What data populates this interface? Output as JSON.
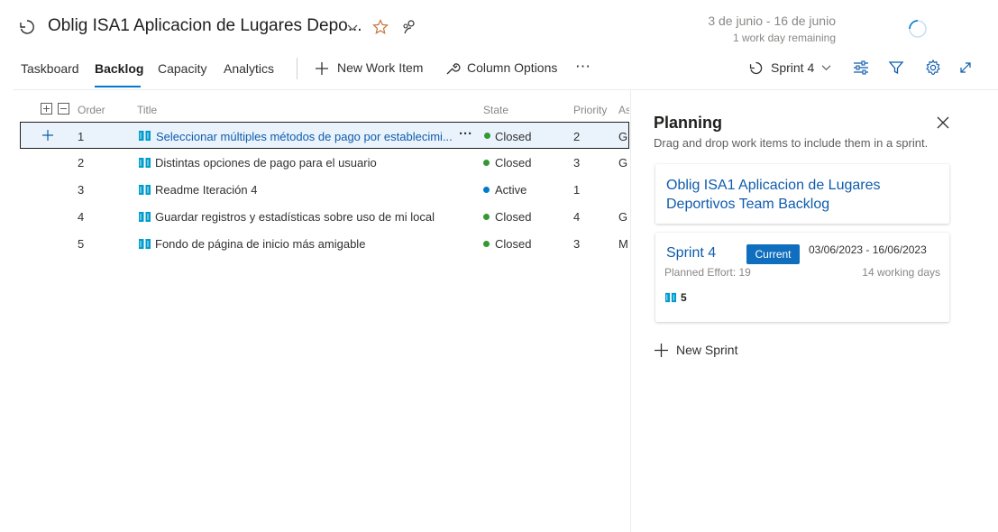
{
  "header": {
    "title": "Oblig ISA1 Aplicacion de Lugares Depo...",
    "sprint_dates": "3 de junio - 16 de junio",
    "sprint_remaining": "1 work day remaining",
    "icons": [
      "sprint-cycle-icon",
      "chevron-down-icon",
      "star-icon",
      "team-members-icon",
      "loading-spinner-icon"
    ]
  },
  "tabs": [
    {
      "label": "Taskboard",
      "active": false
    },
    {
      "label": "Backlog",
      "active": true
    },
    {
      "label": "Capacity",
      "active": false
    },
    {
      "label": "Analytics",
      "active": false
    }
  ],
  "toolbar": {
    "new_work_item": "New Work Item",
    "column_options": "Column Options",
    "more": "⋯",
    "sprint_selector": "Sprint 4"
  },
  "grid": {
    "columns": {
      "order": "Order",
      "title": "Title",
      "state": "State",
      "priority": "Priority",
      "assigned": "As"
    },
    "rows": [
      {
        "order": "1",
        "title": "Seleccionar múltiples métodos de pago por establecimi...",
        "state": "Closed",
        "priority": "2",
        "assigned": "G"
      },
      {
        "order": "2",
        "title": "Distintas opciones de pago para el usuario",
        "state": "Closed",
        "priority": "3",
        "assigned": "G"
      },
      {
        "order": "3",
        "title": "Readme Iteración 4",
        "state": "Active",
        "priority": "1",
        "assigned": ""
      },
      {
        "order": "4",
        "title": "Guardar registros y estadísticas sobre uso de mi local",
        "state": "Closed",
        "priority": "4",
        "assigned": "G"
      },
      {
        "order": "5",
        "title": "Fondo de página de inicio más amigable",
        "state": "Closed",
        "priority": "3",
        "assigned": "M"
      }
    ],
    "state_colors": {
      "Closed": "#339933",
      "Active": "#007acc"
    }
  },
  "planning": {
    "title": "Planning",
    "subtitle": "Drag and drop work items to include them in a sprint.",
    "backlog_card": "Oblig ISA1 Aplicacion de Lugares Deportivos Team Backlog",
    "sprint": {
      "name": "Sprint 4",
      "badge": "Current",
      "dates": "03/06/2023 - 16/06/2023",
      "planned_effort": "Planned Effort: 19",
      "working_days": "14 working days",
      "item_count": "5"
    },
    "new_sprint": "New Sprint"
  },
  "colors": {
    "accent": "#0078d4",
    "link": "#0f5cad",
    "badge": "#106ebe",
    "selected_row": "#eaf3fb"
  }
}
